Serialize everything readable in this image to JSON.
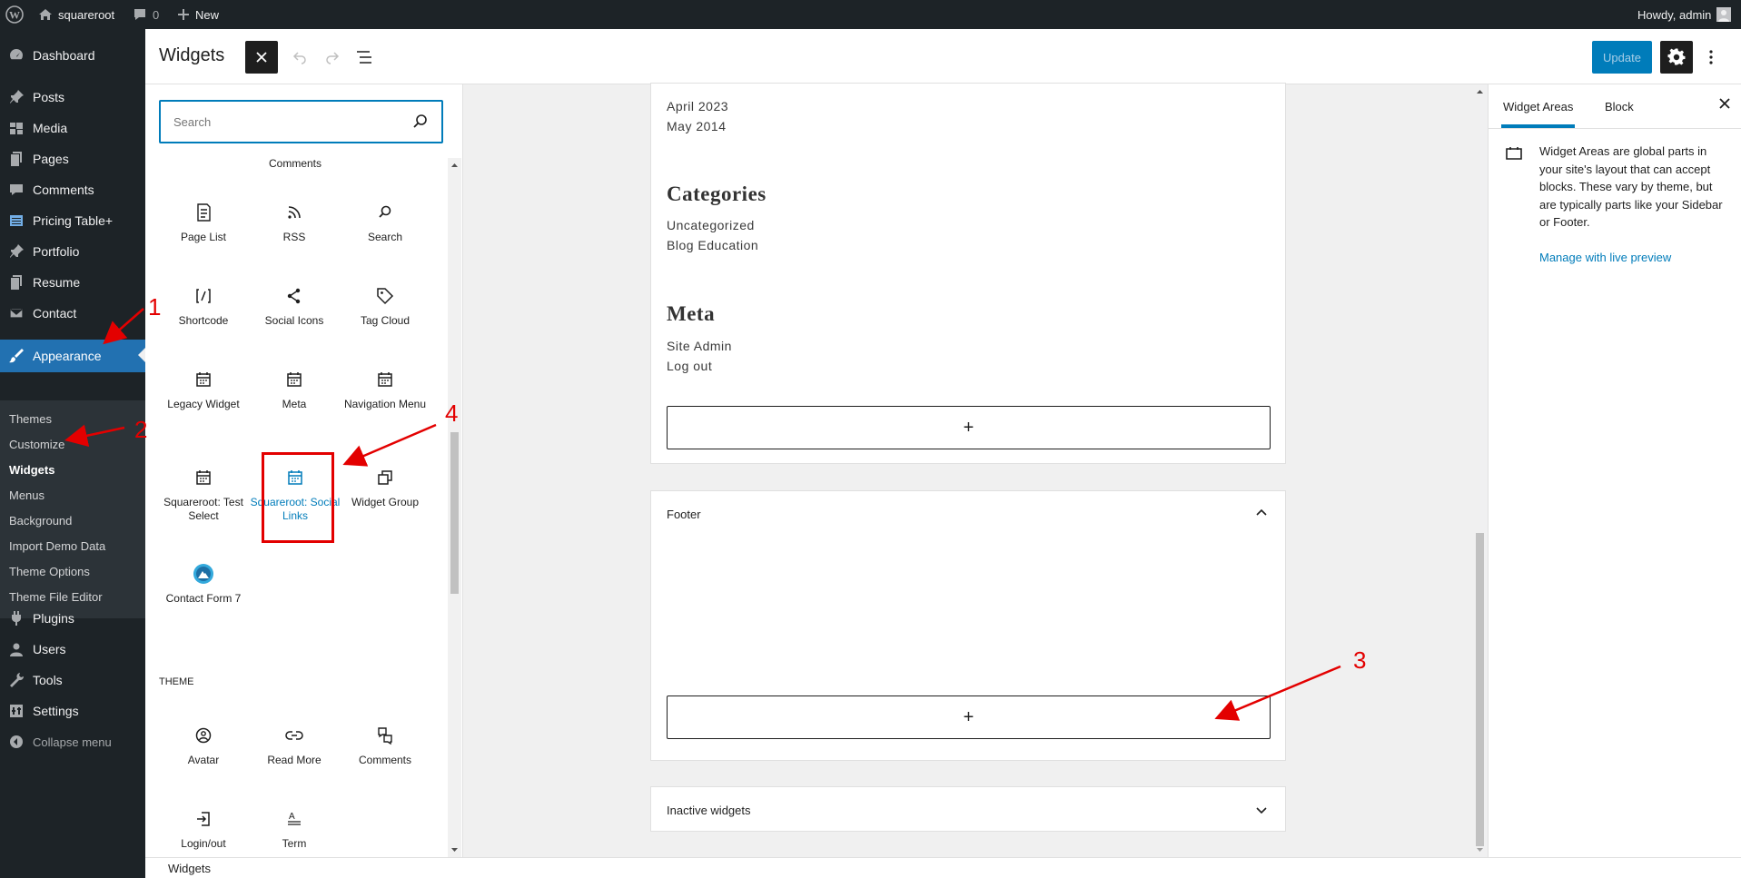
{
  "admin_bar": {
    "site_name": "squareroot",
    "comments_count": "0",
    "new_label": "New",
    "greeting": "Howdy, admin"
  },
  "admin_menu": {
    "items": [
      {
        "label": "Dashboard",
        "icon": "dashboard-icon"
      },
      {
        "label": "Posts",
        "icon": "pin-icon"
      },
      {
        "label": "Media",
        "icon": "media-icon"
      },
      {
        "label": "Pages",
        "icon": "pages-icon"
      },
      {
        "label": "Comments",
        "icon": "comment-icon"
      },
      {
        "label": "Pricing Table+",
        "icon": "table-icon"
      },
      {
        "label": "Portfolio",
        "icon": "pin-icon"
      },
      {
        "label": "Resume",
        "icon": "pages-icon"
      },
      {
        "label": "Contact",
        "icon": "mail-icon"
      },
      {
        "label": "Appearance",
        "icon": "brush-icon"
      }
    ],
    "appearance_submenu": [
      "Themes",
      "Customize",
      "Widgets",
      "Menus",
      "Background",
      "Import Demo Data",
      "Theme Options",
      "Theme File Editor"
    ],
    "lower_items": [
      {
        "label": "Plugins",
        "icon": "plugin-icon"
      },
      {
        "label": "Users",
        "icon": "users-icon"
      },
      {
        "label": "Tools",
        "icon": "wrench-icon"
      },
      {
        "label": "Settings",
        "icon": "settings-icon"
      }
    ],
    "collapse_label": "Collapse menu"
  },
  "header": {
    "title": "Widgets",
    "update_label": "Update"
  },
  "inserter": {
    "search_placeholder": "Search",
    "top_label": "Comments",
    "blocks": [
      {
        "label": "Page List",
        "icon": "page-list-icon"
      },
      {
        "label": "RSS",
        "icon": "rss-icon"
      },
      {
        "label": "Search",
        "icon": "search-icon"
      },
      {
        "label": "Shortcode",
        "icon": "shortcode-icon"
      },
      {
        "label": "Social Icons",
        "icon": "share-icon"
      },
      {
        "label": "Tag Cloud",
        "icon": "tag-icon"
      },
      {
        "label": "Legacy Widget",
        "icon": "calendar-icon"
      },
      {
        "label": "Meta",
        "icon": "calendar-icon"
      },
      {
        "label": "Navigation Menu",
        "icon": "calendar-icon"
      },
      {
        "label": "Squareroot: Test Select",
        "icon": "calendar-icon"
      },
      {
        "label": "Squareroot: Social Links",
        "icon": "calendar-icon"
      },
      {
        "label": "Widget Group",
        "icon": "group-icon"
      },
      {
        "label": "Contact Form 7",
        "icon": "contact-form-icon"
      }
    ],
    "theme_heading": "THEME",
    "theme_blocks": [
      {
        "label": "Avatar",
        "icon": "avatar-icon"
      },
      {
        "label": "Read More",
        "icon": "link-icon"
      },
      {
        "label": "Comments",
        "icon": "comments-block-icon"
      },
      {
        "label": "Login/out",
        "icon": "login-icon"
      },
      {
        "label": "Term",
        "icon": "term-icon"
      }
    ]
  },
  "canvas": {
    "archives": [
      "April 2023",
      "May 2014"
    ],
    "categories_title": "Categories",
    "categories": [
      "Uncategorized",
      "Blog Education"
    ],
    "meta_title": "Meta",
    "meta_links": [
      "Site Admin",
      "Log out"
    ],
    "add_block_symbol": "+",
    "footer_area_title": "Footer",
    "inactive_title": "Inactive widgets"
  },
  "sidebar": {
    "tabs": [
      "Widget Areas",
      "Block"
    ],
    "description": "Widget Areas are global parts in your site's layout that can accept blocks. These vary by theme, but are typically parts like your Sidebar or Footer.",
    "link_label": "Manage with live preview"
  },
  "footer": {
    "breadcrumb": "Widgets"
  },
  "annotations": [
    "1",
    "2",
    "3",
    "4"
  ],
  "colors": {
    "admin_dark": "#1d2327",
    "accent": "#2271b1",
    "wp_blue": "#007cba",
    "annotation_red": "#e30000"
  }
}
